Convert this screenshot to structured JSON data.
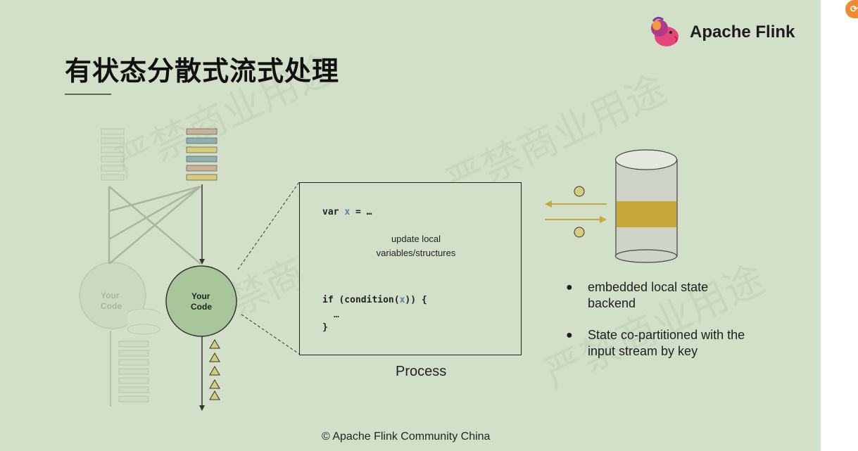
{
  "title": "有状态分散式流式处理",
  "brand": {
    "name": "Apache Flink",
    "logo_icon": "flink-squirrel-icon"
  },
  "operator_faded": {
    "label_line1": "Your",
    "label_line2": "Code"
  },
  "operator": {
    "label_line1": "Your",
    "label_line2": "Code"
  },
  "code": {
    "line1_keyword": "var ",
    "line1_var": "x",
    "line1_rest": " = …",
    "note_line1": "update local",
    "note_line2": "variables/structures",
    "line2_prefix": "if (condition(",
    "line2_var": "x",
    "line2_suffix": ")) {",
    "line3": "…",
    "line4": "}"
  },
  "process_label": "Process",
  "state": {
    "bullets": [
      "embedded local state backend",
      "State co-partitioned with the input stream by key"
    ]
  },
  "footer": "© Apache Flink Community China",
  "watermark_text": "严禁商业用途",
  "colors": {
    "background": "#d3e0c9",
    "node_fill": "#a9c69a",
    "state_band": "#c8a63a",
    "arrow": "#c8a63a",
    "record_colors": [
      "#c9b29a",
      "#8fb1ad",
      "#d6cc7c",
      "#8fb1ad",
      "#c9b29a",
      "#d6cc7c"
    ]
  }
}
